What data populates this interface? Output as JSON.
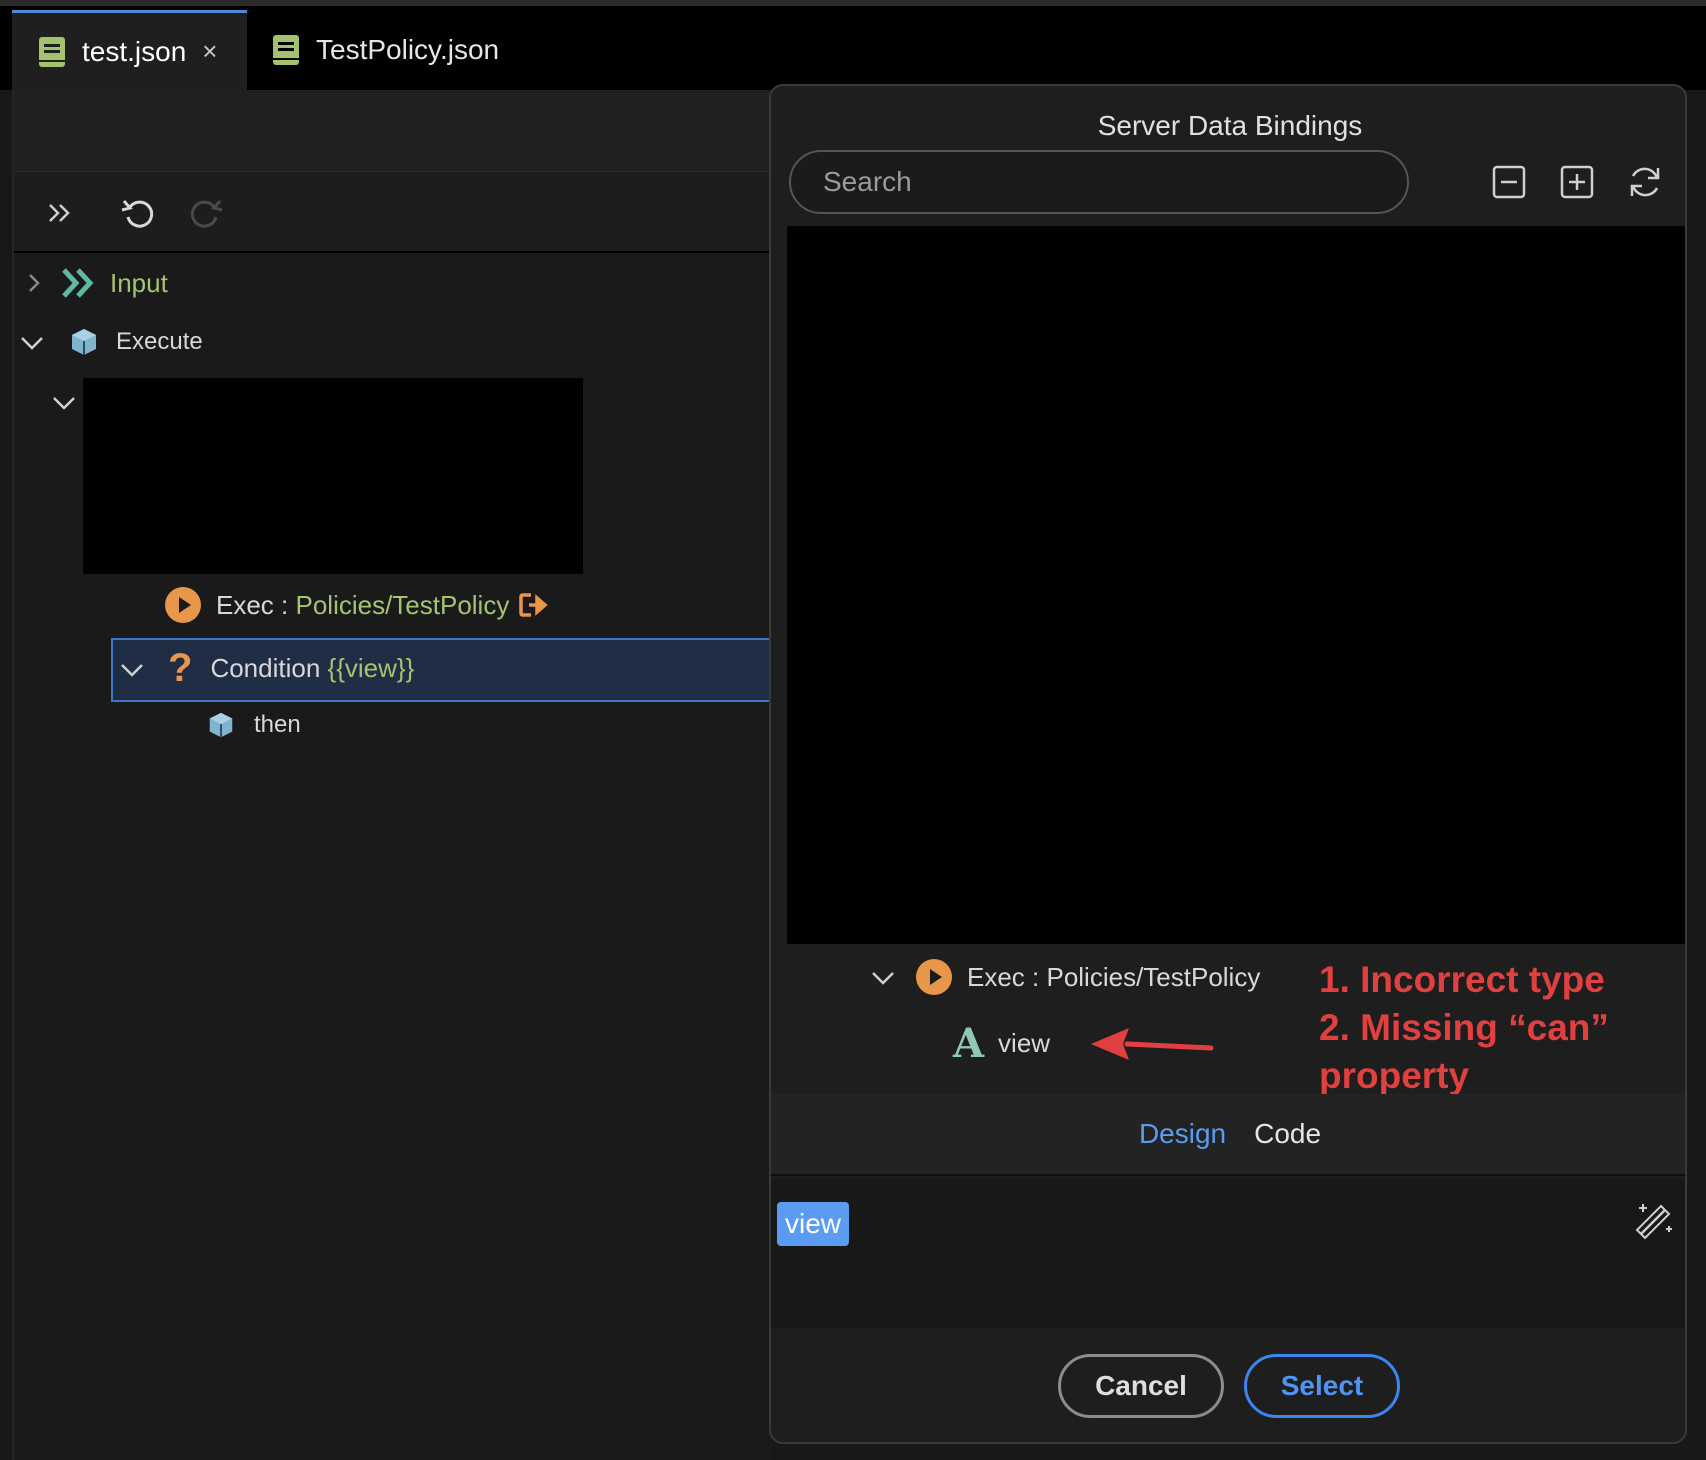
{
  "tabs": [
    {
      "label": "test.json",
      "close": "×"
    },
    {
      "label": "TestPolicy.json"
    }
  ],
  "tree": {
    "input": "Input",
    "execute": "Execute",
    "exec_prefix": "Exec : ",
    "exec_path": "Policies/TestPolicy",
    "condition_label": "Condition ",
    "condition_value": "{{view}}",
    "then": "then"
  },
  "dialog": {
    "title": "Server Data Bindings",
    "search_placeholder": "Search",
    "exec_node": "Exec : Policies/TestPolicy",
    "type_glyph": "A",
    "view_node": "view",
    "annotation": {
      "line1": "1. Incorrect type",
      "line2": "2. Missing “can”",
      "line3": "property"
    },
    "tabs": {
      "design": "Design",
      "code": "Code"
    },
    "chip": "view",
    "cancel": "Cancel",
    "select": "Select"
  },
  "colors": {
    "accent_blue": "#4f94f3",
    "annotation_red": "#e0403f",
    "string_green": "#a6c36f",
    "exec_orange": "#e8974a"
  }
}
